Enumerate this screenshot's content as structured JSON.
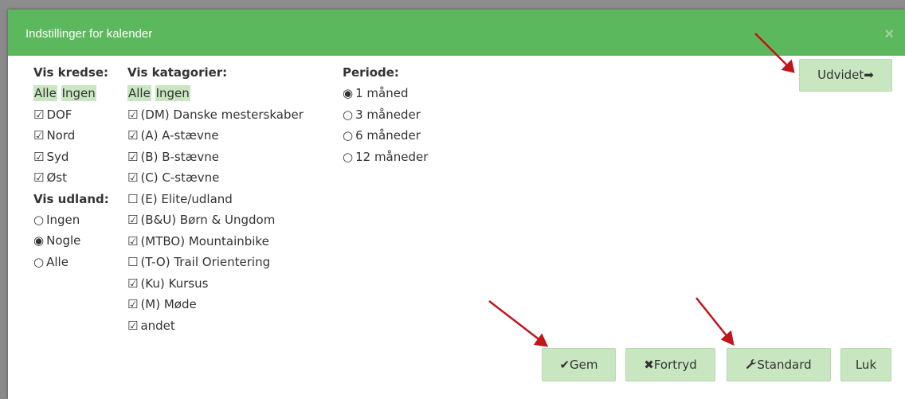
{
  "dialog": {
    "title": "Indstillinger for kalender",
    "close_glyph": "×"
  },
  "kredse": {
    "header": "Vis kredse:",
    "all": "Alle",
    "none": "Ingen",
    "items": [
      {
        "label": "DOF",
        "checked": true
      },
      {
        "label": "Nord",
        "checked": true
      },
      {
        "label": "Syd",
        "checked": true
      },
      {
        "label": "Øst",
        "checked": true
      }
    ]
  },
  "udland": {
    "header": "Vis udland:",
    "options": [
      {
        "label": "Ingen",
        "selected": false
      },
      {
        "label": "Nogle",
        "selected": true
      },
      {
        "label": "Alle",
        "selected": false
      }
    ]
  },
  "kategorier": {
    "header": "Vis katagorier:",
    "all": "Alle",
    "none": "Ingen",
    "items": [
      {
        "label": "(DM) Danske mesterskaber",
        "checked": true
      },
      {
        "label": "(A) A-stævne",
        "checked": true
      },
      {
        "label": "(B) B-stævne",
        "checked": true
      },
      {
        "label": "(C) C-stævne",
        "checked": true
      },
      {
        "label": "(E) Elite/udland",
        "checked": false
      },
      {
        "label": "(B&U) Børn & Ungdom",
        "checked": true
      },
      {
        "label": "(MTBO) Mountainbike",
        "checked": true
      },
      {
        "label": "(T-O) Trail Orientering",
        "checked": false
      },
      {
        "label": "(Ku) Kursus",
        "checked": true
      },
      {
        "label": "(M) Møde",
        "checked": true
      },
      {
        "label": "andet",
        "checked": true
      }
    ]
  },
  "periode": {
    "header": "Periode:",
    "options": [
      {
        "label": "1 måned",
        "selected": true
      },
      {
        "label": "3 måneder",
        "selected": false
      },
      {
        "label": "6 måneder",
        "selected": false
      },
      {
        "label": "12 måneder",
        "selected": false
      }
    ]
  },
  "buttons": {
    "udvidet": "Udvidet",
    "udvidet_icon": "➡",
    "gem": "Gem",
    "gem_icon": "✔",
    "fortryd": "Fortryd",
    "fortryd_icon": "✖",
    "standard": "Standard",
    "standard_icon": "wrench-icon",
    "luk": "Luk"
  },
  "colors": {
    "titlebar": "#5cb85c",
    "button_bg": "#c8e6c0",
    "annotation_arrow": "#c0151b"
  }
}
